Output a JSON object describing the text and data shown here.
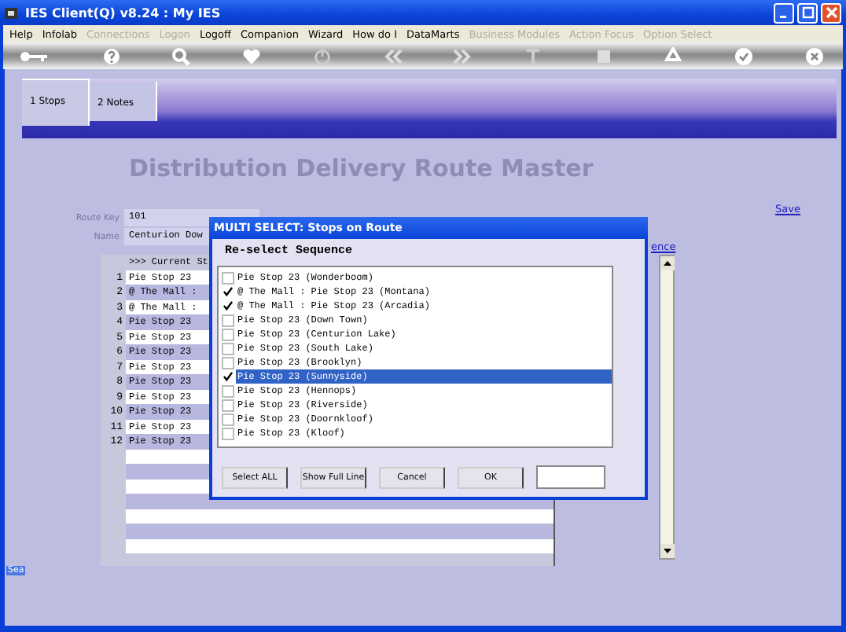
{
  "window": {
    "title": "IES Client(Q) v8.24 : My IES"
  },
  "menu": [
    {
      "label": "Help",
      "disabled": false
    },
    {
      "label": "Infolab",
      "disabled": false
    },
    {
      "label": "Connections",
      "disabled": true
    },
    {
      "label": "Logon",
      "disabled": true
    },
    {
      "label": "Logoff",
      "disabled": false
    },
    {
      "label": "Companion",
      "disabled": false
    },
    {
      "label": "Wizard",
      "disabled": false
    },
    {
      "label": "How do I",
      "disabled": false
    },
    {
      "label": "DataMarts",
      "disabled": false
    },
    {
      "label": "Business Modules",
      "disabled": true
    },
    {
      "label": "Action Focus",
      "disabled": true
    },
    {
      "label": "Option Select",
      "disabled": true
    }
  ],
  "tabs": [
    {
      "label": "1 Stops",
      "selected": true
    },
    {
      "label": "2 Notes",
      "selected": false
    }
  ],
  "heading": "Distribution Delivery Route Master",
  "save_link": "Save",
  "fields": [
    {
      "label": "Route Key",
      "value": "101"
    },
    {
      "label": "Name",
      "value": "Centurion Dow"
    }
  ],
  "sequence_link": "ence",
  "grid": {
    "header": ">>> Current St",
    "rows": [
      {
        "number": "1",
        "stop": "Pie Stop 23"
      },
      {
        "number": "2",
        "stop": "@ The Mall :"
      },
      {
        "number": "3",
        "stop": "@ The Mall :"
      },
      {
        "number": "4",
        "stop": "Pie Stop 23"
      },
      {
        "number": "5",
        "stop": "Pie Stop 23"
      },
      {
        "number": "6",
        "stop": "Pie Stop 23"
      },
      {
        "number": "7",
        "stop": "Pie Stop 23"
      },
      {
        "number": "8",
        "stop": "Pie Stop 23"
      },
      {
        "number": "9",
        "stop": "Pie Stop 23"
      },
      {
        "number": "10",
        "stop": "Pie Stop 23"
      },
      {
        "number": "11",
        "stop": "Pie Stop 23"
      },
      {
        "number": "12",
        "stop": "Pie Stop 23"
      }
    ]
  },
  "side_tab": "Sea",
  "dialog": {
    "title": "MULTI SELECT: Stops on Route",
    "heading": "Re-select Sequence",
    "items": [
      {
        "label": "Pie Stop 23 (Wonderboom)",
        "checked": false,
        "selected": false
      },
      {
        "label": "@ The Mall : Pie Stop 23 (Montana)",
        "checked": true,
        "selected": false
      },
      {
        "label": "@ The Mall : Pie Stop 23 (Arcadia)",
        "checked": true,
        "selected": false
      },
      {
        "label": "Pie Stop 23 (Down Town)",
        "checked": false,
        "selected": false
      },
      {
        "label": "Pie Stop 23 (Centurion Lake)",
        "checked": false,
        "selected": false
      },
      {
        "label": "Pie Stop 23 (South Lake)",
        "checked": false,
        "selected": false
      },
      {
        "label": "Pie Stop 23 (Brooklyn)",
        "checked": false,
        "selected": false
      },
      {
        "label": "Pie Stop 23 (Sunnyside)",
        "checked": true,
        "selected": true
      },
      {
        "label": "Pie Stop 23 (Hennops)",
        "checked": false,
        "selected": false
      },
      {
        "label": "Pie Stop 23 (Riverside)",
        "checked": false,
        "selected": false
      },
      {
        "label": "Pie Stop 23 (Doornkloof)",
        "checked": false,
        "selected": false
      },
      {
        "label": "Pie Stop 23 (Kloof)",
        "checked": false,
        "selected": false
      }
    ],
    "buttons": [
      "Select ALL",
      "Show Full Line",
      "Cancel",
      "OK"
    ]
  }
}
